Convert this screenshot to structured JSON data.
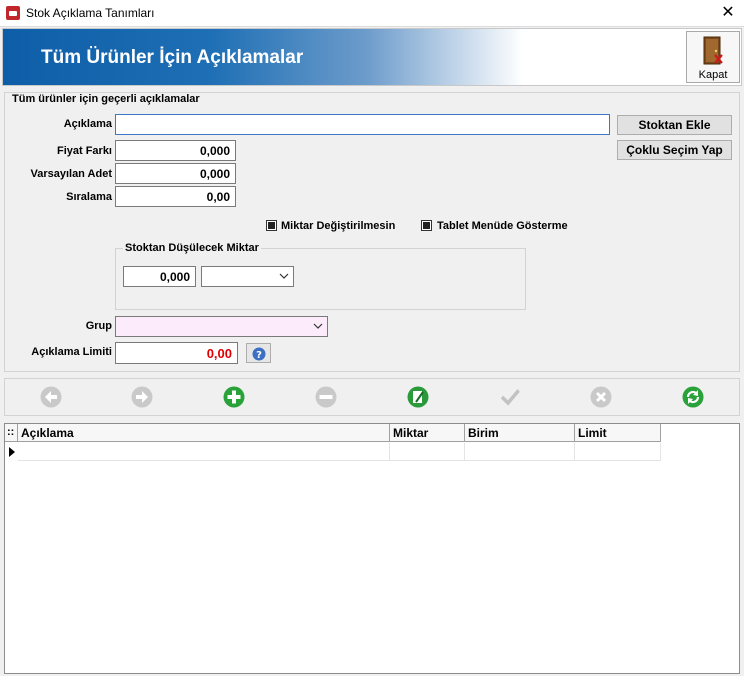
{
  "window": {
    "title": "Stok Açıklama Tanımları",
    "close_glyph": "✕"
  },
  "header": {
    "title": "Tüm Ürünler İçin Açıklamalar",
    "close_label": "Kapat"
  },
  "group": {
    "title": "Tüm ürünler için geçerli açıklamalar",
    "aciklama": {
      "label": "Açıklama",
      "value": ""
    },
    "fiyat_farki": {
      "label": "Fiyat Farkı",
      "value": "0,000"
    },
    "varsayilan_adet": {
      "label": "Varsayılan Adet",
      "value": "0,000"
    },
    "siralama": {
      "label": "Sıralama",
      "value": "0,00"
    },
    "stoktan_ekle": "Stoktan Ekle",
    "coklu_secim": "Çoklu Seçim Yap",
    "miktar_degistirilmesin": "Miktar Değiştirilmesin",
    "tablet_menude_gosterme": "Tablet Menüde Gösterme",
    "stok_group": {
      "title": "Stoktan Düşülecek Miktar",
      "amount": "0,000",
      "unit": ""
    },
    "grup": {
      "label": "Grup",
      "value": ""
    },
    "aciklama_limiti": {
      "label": "Açıklama Limiti",
      "value": "0,00"
    }
  },
  "toolbar": {
    "icons": [
      "back-icon",
      "forward-icon",
      "add-icon",
      "remove-icon",
      "edit-icon",
      "confirm-icon",
      "cancel-icon",
      "refresh-icon"
    ]
  },
  "grid": {
    "columns": [
      "Açıklama",
      "Miktar",
      "Birim",
      "Limit"
    ]
  },
  "colors": {
    "accent": "#0e5da8",
    "limit_value": "#e00000",
    "grup_bg": "#fcecfb"
  }
}
